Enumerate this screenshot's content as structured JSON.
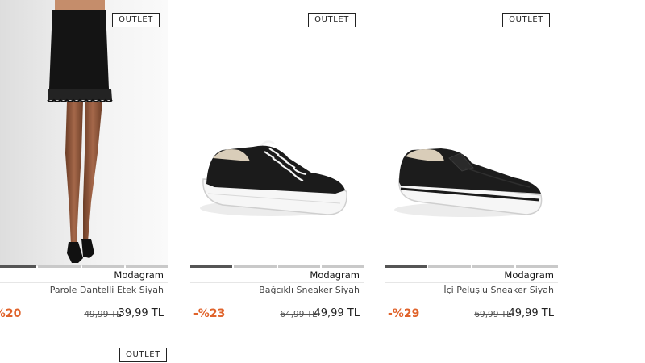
{
  "products": [
    {
      "badge": "OUTLET",
      "brand": "Modagram",
      "name": "Parole Dantelli Etek Siyah",
      "discount": "-%20",
      "old_price": "49,99 TL",
      "new_price": "39,99 TL",
      "image_icon": "skirt-photo"
    },
    {
      "badge": "OUTLET",
      "brand": "Modagram",
      "name": "Bağcıklı Sneaker Siyah",
      "discount": "-%23",
      "old_price": "64,99 TL",
      "new_price": "49,99 TL",
      "image_icon": "lace-up-sneaker-photo"
    },
    {
      "badge": "OUTLET",
      "brand": "Modagram",
      "name": "İçi Peluşlu Sneaker Siyah",
      "discount": "-%29",
      "old_price": "69,99 TL",
      "new_price": "49,99 TL",
      "image_icon": "slip-on-sneaker-photo"
    }
  ],
  "row2": {
    "badge": "OUTLET"
  },
  "colors": {
    "discount": "#e0632b",
    "text": "#222222",
    "carousel_active": "#555555",
    "carousel_inactive": "#c9c9c9"
  }
}
